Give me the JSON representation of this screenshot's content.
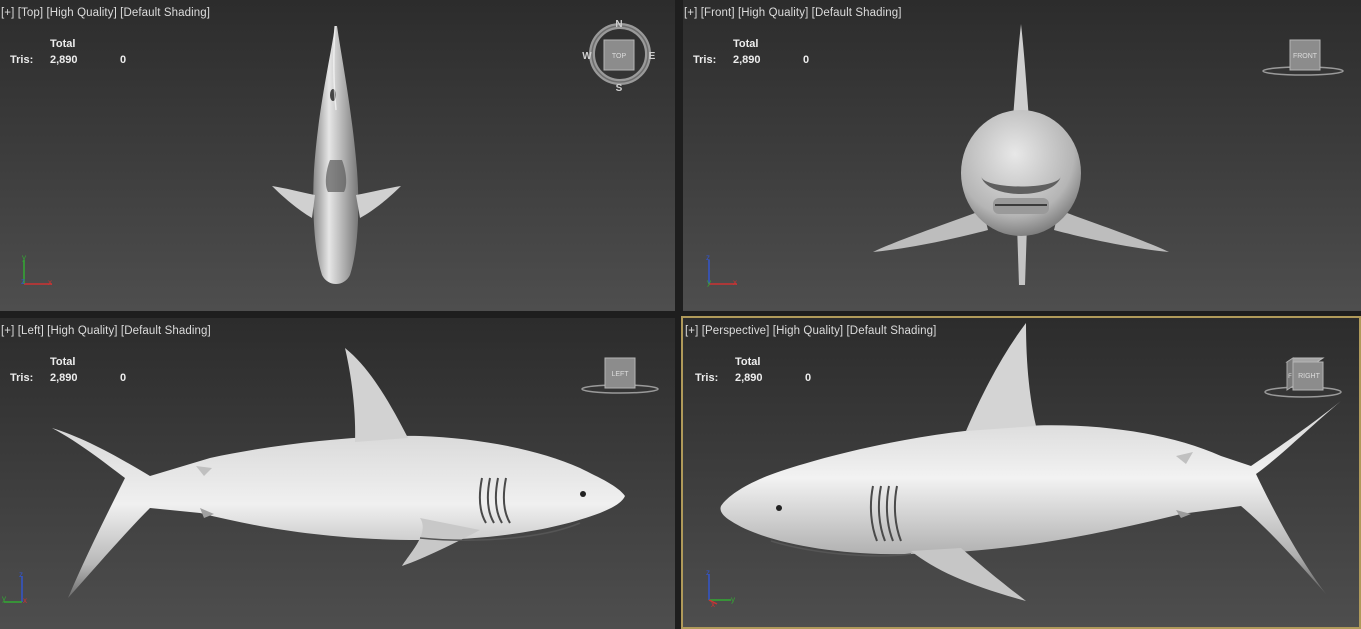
{
  "viewports": {
    "top": {
      "label": [
        "[+]",
        "[Top]",
        "[High Quality]",
        "[Default Shading]"
      ],
      "cube_face": "TOP",
      "compass": {
        "n": "N",
        "s": "S",
        "e": "E",
        "w": "W"
      },
      "axes": {
        "a": "y",
        "b": "x",
        "c": "z"
      }
    },
    "front": {
      "label": [
        "[+]",
        "[Front]",
        "[High Quality]",
        "[Default Shading]"
      ],
      "cube_face": "FRONT",
      "axes": {
        "a": "z",
        "b": "x",
        "c": "y"
      }
    },
    "left": {
      "label": [
        "[+]",
        "[Left]",
        "[High Quality]",
        "[Default Shading]"
      ],
      "cube_face": "LEFT",
      "axes": {
        "a": "z",
        "b": "y",
        "c": "x"
      }
    },
    "perspective": {
      "label": [
        "[+]",
        "[Perspective]",
        "[High Quality]",
        "[Default Shading]"
      ],
      "cube_face": "RIGHT",
      "cube_side": "F",
      "axes": {
        "a": "z",
        "b": "y",
        "c": "x"
      }
    }
  },
  "stats": {
    "total_label": "Total",
    "tris_label": "Tris:",
    "tris_total": "2,890",
    "tris_selected": "0"
  },
  "colors": {
    "active_border": "#b09a5a",
    "axis_x": "#cc3333",
    "axis_y": "#33aa33",
    "axis_z": "#3355cc"
  }
}
